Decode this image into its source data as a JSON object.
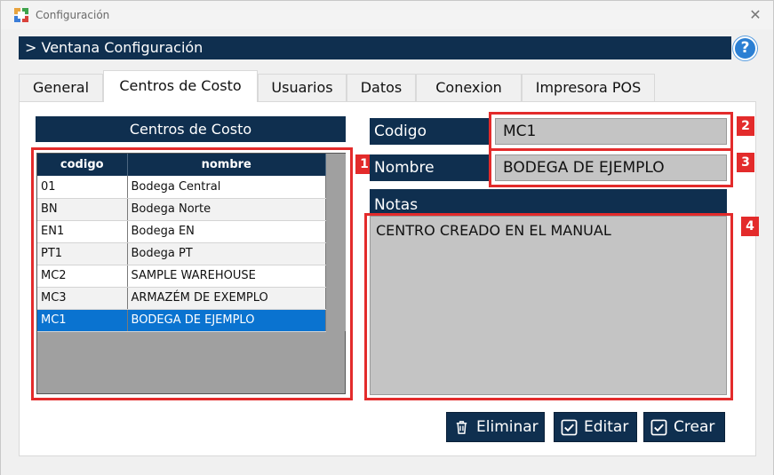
{
  "window": {
    "title": "Configuración",
    "close_glyph": "✕"
  },
  "header": {
    "title": "> Ventana Configuración",
    "help_glyph": "?"
  },
  "tabs": [
    {
      "label": "General"
    },
    {
      "label": "Centros de Costo"
    },
    {
      "label": "Usuarios"
    },
    {
      "label": "Datos"
    },
    {
      "label": "Conexion"
    },
    {
      "label": "Impresora POS"
    }
  ],
  "cost_centers": {
    "title": "Centros de Costo",
    "columns": [
      "codigo",
      "nombre"
    ],
    "rows": [
      {
        "codigo": "01",
        "nombre": "Bodega Central"
      },
      {
        "codigo": "BN",
        "nombre": "Bodega Norte"
      },
      {
        "codigo": "EN1",
        "nombre": "Bodega EN"
      },
      {
        "codigo": "PT1",
        "nombre": "Bodega PT"
      },
      {
        "codigo": "MC2",
        "nombre": "SAMPLE WAREHOUSE"
      },
      {
        "codigo": "MC3",
        "nombre": "ARMAZÉM DE EXEMPLO"
      },
      {
        "codigo": "MC1",
        "nombre": "BODEGA DE EJEMPLO"
      }
    ]
  },
  "form": {
    "codigo_label": "Codigo",
    "codigo_value": "MC1",
    "nombre_label": "Nombre",
    "nombre_value": "BODEGA DE EJEMPLO",
    "notas_label": "Notas",
    "notas_value": "CENTRO CREADO EN EL MANUAL"
  },
  "badges": [
    "1",
    "2",
    "3",
    "4"
  ],
  "buttons": {
    "eliminar": "Eliminar",
    "editar": "Editar",
    "crear": "Crear"
  },
  "colors": {
    "navy": "#0f2f4f",
    "highlight": "#e32b2b",
    "selection": "#0a73d0"
  }
}
